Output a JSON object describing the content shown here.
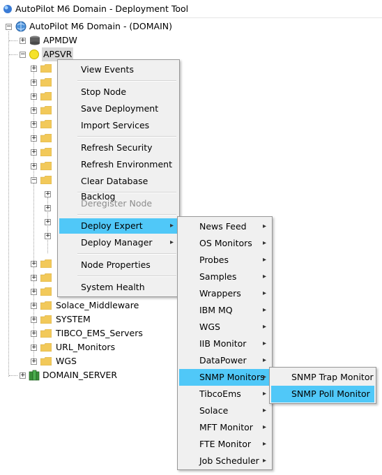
{
  "window": {
    "title": "AutoPilot M6 Domain - Deployment Tool"
  },
  "tree": {
    "root_label": "AutoPilot M6 Domain - (DOMAIN)",
    "apmdw_label": "APMDW",
    "apsvr_label": "APSVR",
    "folders_after": [
      "Solace_Middleware",
      "SYSTEM",
      "TIBCO_EMS_Servers",
      "URL_Monitors",
      "WGS"
    ],
    "domain_server_label": "DOMAIN_SERVER"
  },
  "context_menu": {
    "items": [
      "View Events",
      "Stop Node",
      "Save Deployment",
      "Import Services",
      "Refresh Security",
      "Refresh Environment",
      "Clear Database Backlog",
      "Deregister Node",
      "Deploy Expert",
      "Deploy Manager",
      "Node Properties",
      "System Health"
    ]
  },
  "deploy_expert_menu": {
    "items": [
      "News Feed",
      "OS Monitors",
      "Probes",
      "Samples",
      "Wrappers",
      "IBM MQ",
      "WGS",
      "IIB Monitor",
      "DataPower",
      "SNMP Monitors",
      "TibcoEms",
      "Solace",
      "MFT Monitor",
      "FTE Monitor",
      "Job Scheduler"
    ]
  },
  "snmp_menu": {
    "items": [
      "SNMP Trap Monitor",
      "SNMP Poll Monitor"
    ]
  },
  "colors": {
    "highlight": "#50c8f8",
    "menu_bg": "#f0f0f0",
    "folder": "#f2c95a"
  },
  "icons": {
    "arrow": "▸"
  }
}
